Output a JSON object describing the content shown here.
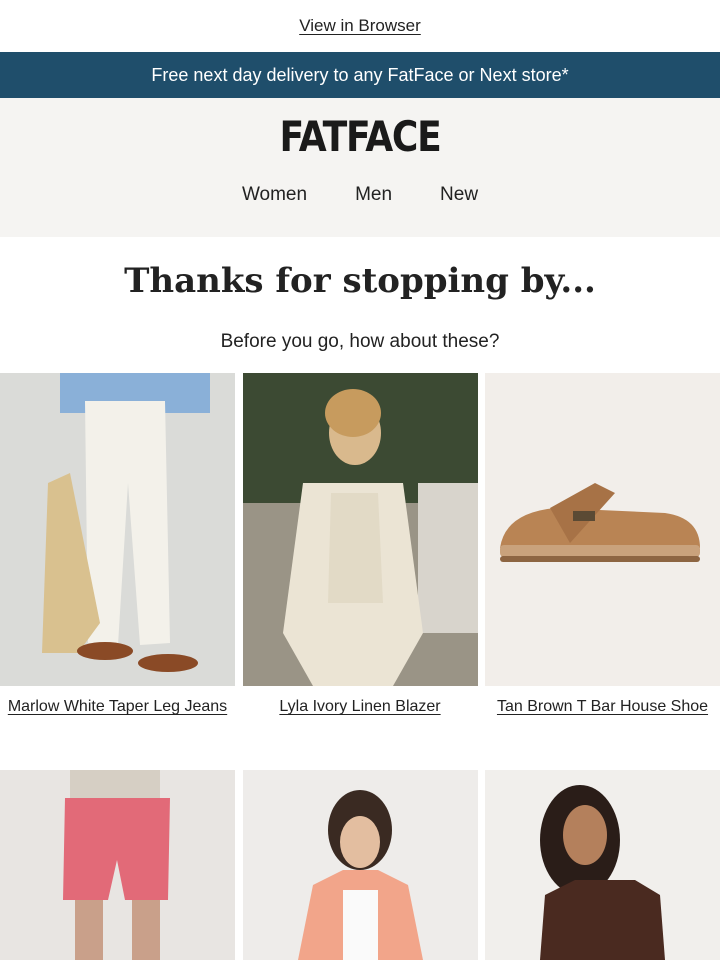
{
  "email": {
    "view_in_browser": "View in Browser",
    "banner_text": "Free next day delivery to any FatFace or Next store*",
    "brand": "FATFACE",
    "nav": [
      {
        "label": "Women"
      },
      {
        "label": "Men"
      },
      {
        "label": "New"
      }
    ],
    "headline": "Thanks for stopping by...",
    "subhead": "Before you go, how about these?",
    "products_row1": [
      {
        "name": "Marlow White Taper Leg Jeans"
      },
      {
        "name": "Lyla Ivory Linen Blazer"
      },
      {
        "name": "Tan Brown T Bar House Shoe"
      }
    ],
    "products_row2_icons": [
      "pink-shorts-photo",
      "peach-hoodie-photo",
      "brown-lace-top-photo"
    ]
  },
  "colors": {
    "banner": "#1f4e6b",
    "header_bg": "#f5f4f2",
    "text": "#222222"
  }
}
